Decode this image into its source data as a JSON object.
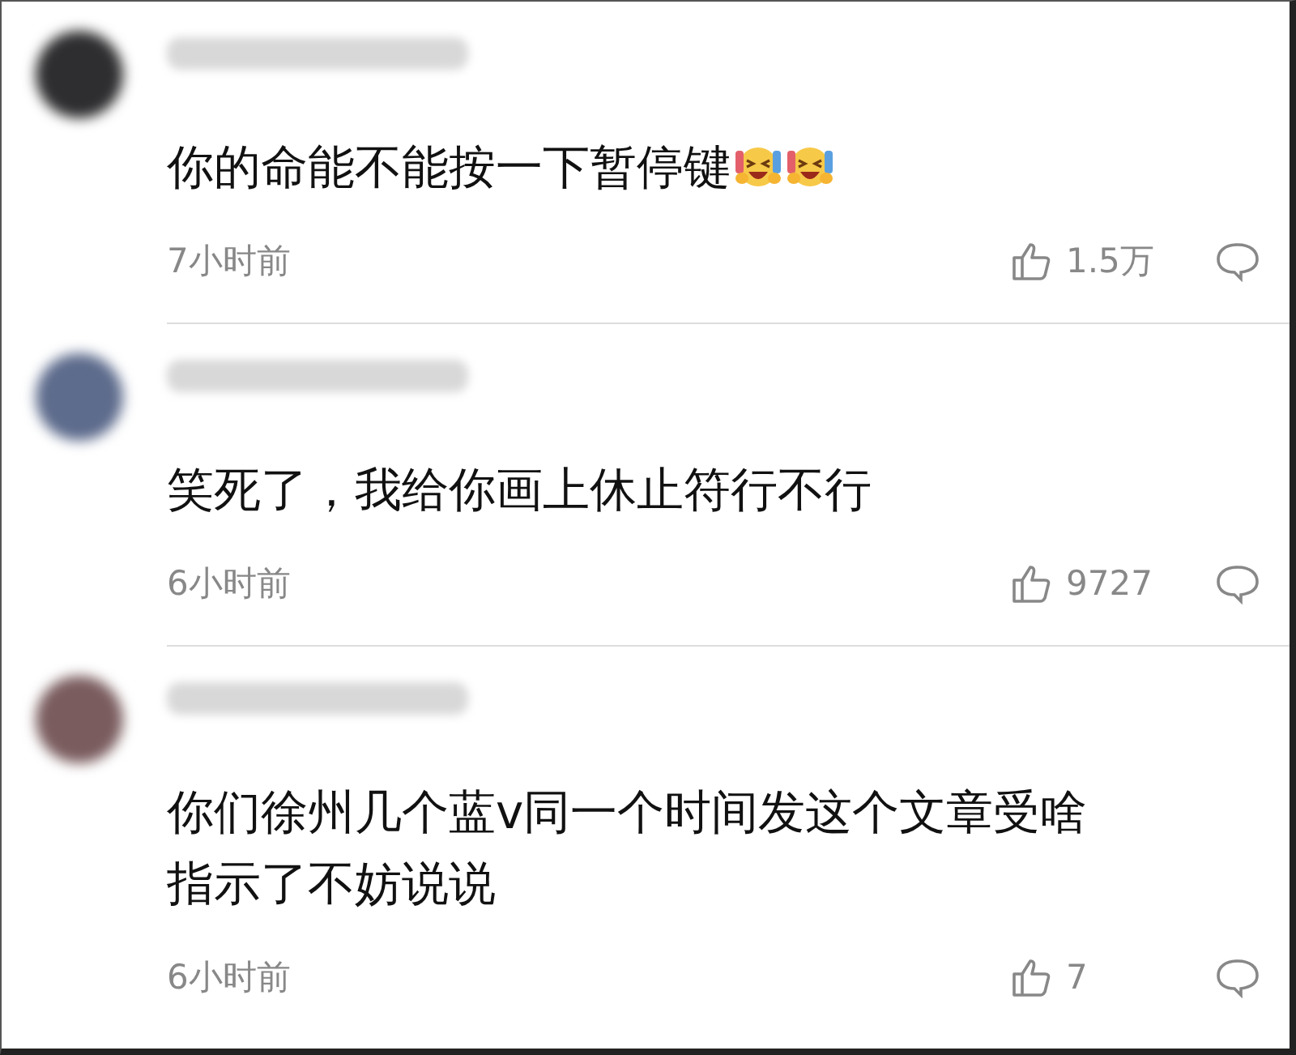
{
  "comments": [
    {
      "avatar": {
        "color": "#2e2e30"
      },
      "lines": [
        "你的命能不能按一下暂停键"
      ],
      "emojis": [
        {
          "kind": "laughing"
        },
        {
          "kind": "laughing"
        }
      ],
      "time": "7小时前",
      "likes": "1.5万"
    },
    {
      "avatar": {
        "color": "#5d6b8c"
      },
      "lines": [
        "笑死了，我给你画上休止符行不行"
      ],
      "time": "6小时前",
      "likes": "9727"
    },
    {
      "avatar": {
        "color": "#7a5c5e"
      },
      "lines": [
        "你们徐州几个蓝v同一个时间发这个文章受啥",
        "指示了不妨说说"
      ],
      "time": "6小时前",
      "likes": "7"
    }
  ]
}
